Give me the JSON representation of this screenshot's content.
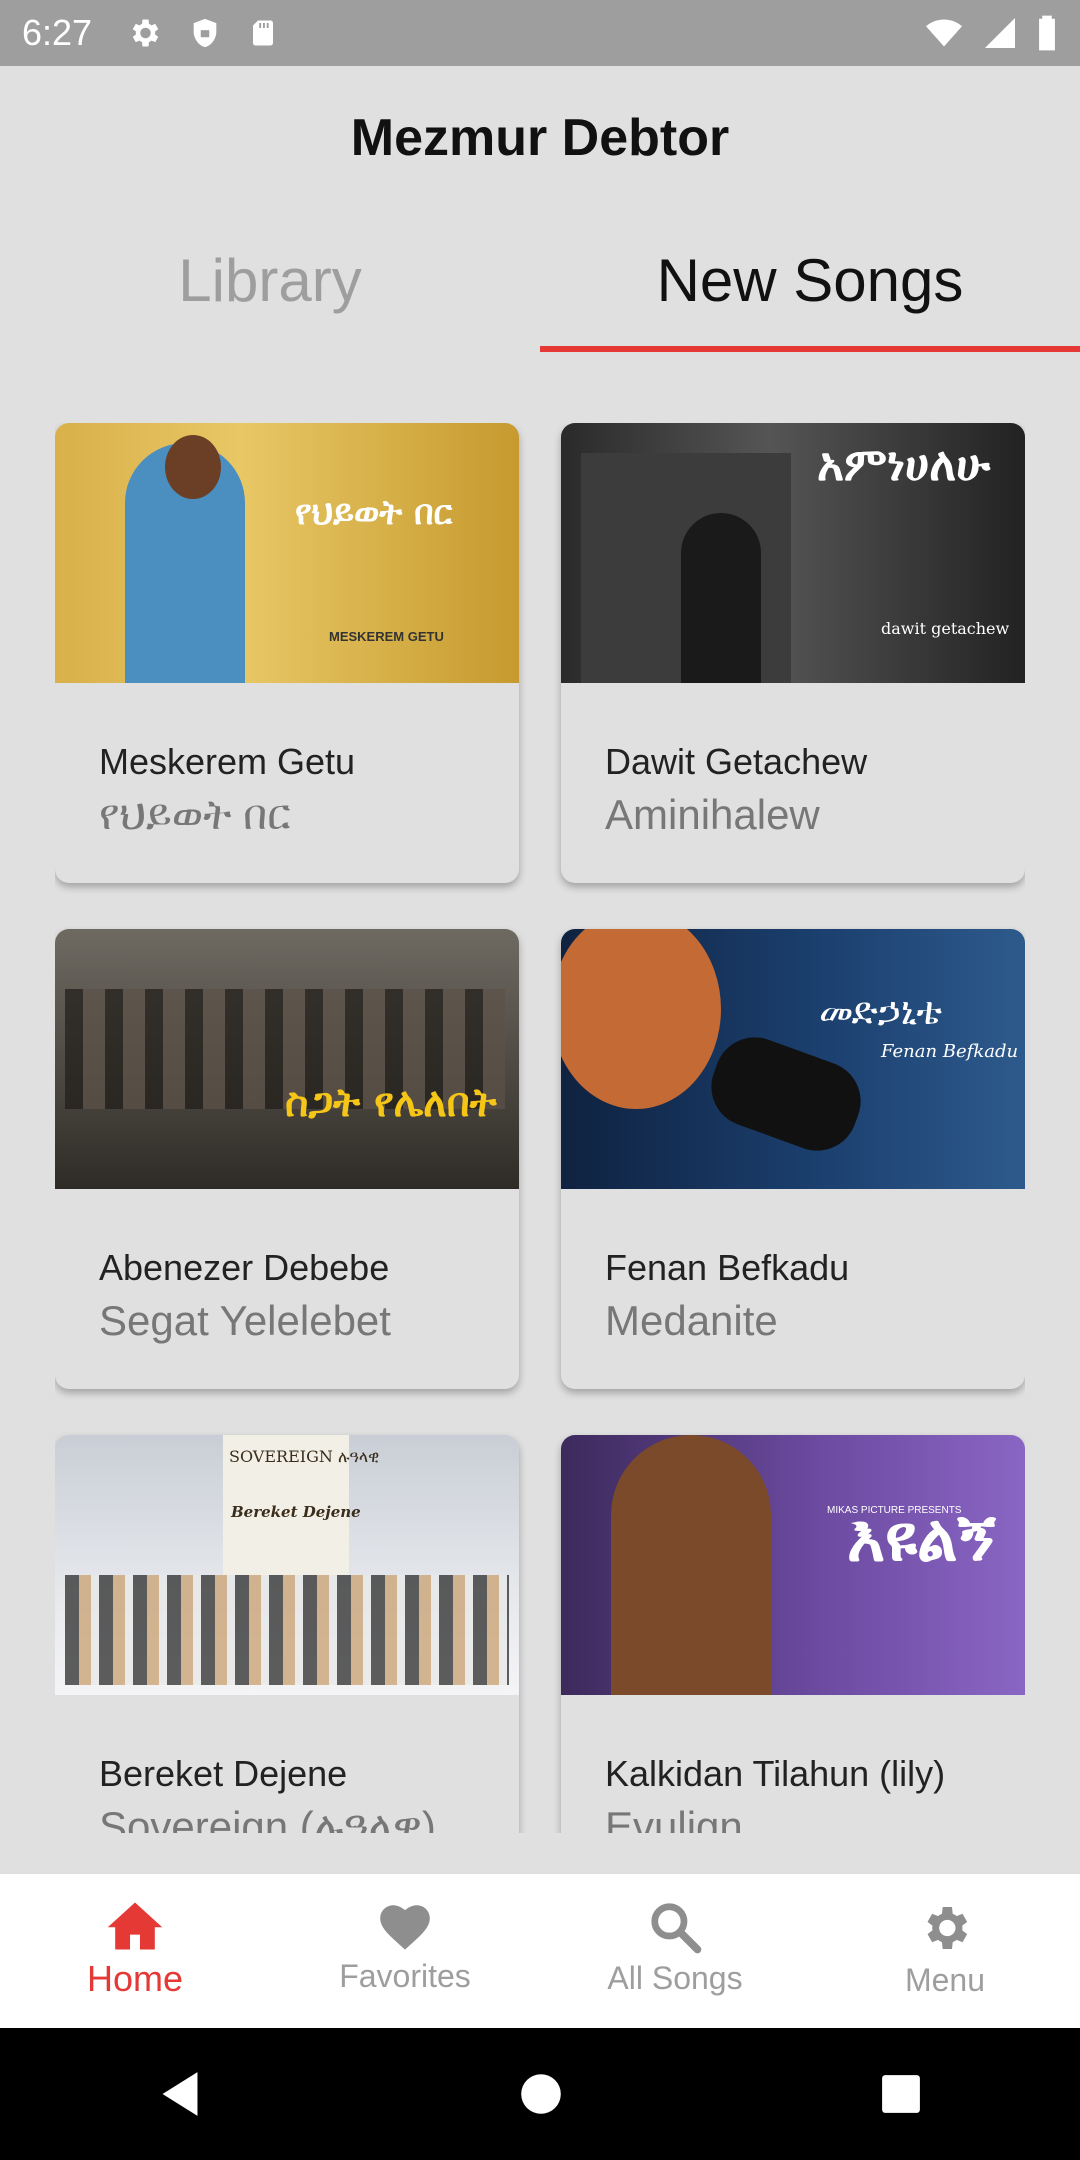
{
  "status_bar": {
    "time": "6:27"
  },
  "app": {
    "title": "Mezmur Debtor"
  },
  "tabs": [
    {
      "label": "Library",
      "active": false
    },
    {
      "label": "New Songs",
      "active": true
    }
  ],
  "cards": [
    {
      "artist": "Meskerem Getu",
      "song": "የህይወት በር",
      "thumb_text": "የህይወት በር",
      "thumb_sub": "MESKEREM GETU"
    },
    {
      "artist": "Dawit Getachew",
      "song": "Aminihalew",
      "thumb_text": "አምነሀለሁ",
      "thumb_sub": "dawit getachew"
    },
    {
      "artist": "Abenezer Debebe",
      "song": "Segat Yelelebet",
      "thumb_text": "ስጋት የሌለበት",
      "thumb_sub": ""
    },
    {
      "artist": "Fenan Befkadu",
      "song": "Medanite",
      "thumb_text": "መድኃኒቴ",
      "thumb_sub": "Fenan Befkadu"
    },
    {
      "artist": "Bereket Dejene",
      "song": "Sovereign (ሉዓላዊ)",
      "thumb_text": "SOVEREIGN ሉዓላዊ",
      "thumb_sub": "Bereket Dejene"
    },
    {
      "artist": "Kalkidan Tilahun (lily)",
      "song": "Evulign",
      "thumb_text": "እዩልኝ",
      "thumb_sub": "MIKAS PICTURE PRESENTS"
    }
  ],
  "bottom_nav": [
    {
      "label": "Home",
      "icon": "home-icon",
      "active": true
    },
    {
      "label": "Favorites",
      "icon": "heart-icon",
      "active": false
    },
    {
      "label": "All Songs",
      "icon": "search-icon",
      "active": false
    },
    {
      "label": "Menu",
      "icon": "gear-icon",
      "active": false
    }
  ],
  "colors": {
    "accent": "#e53935",
    "background": "#e0e0e0"
  }
}
